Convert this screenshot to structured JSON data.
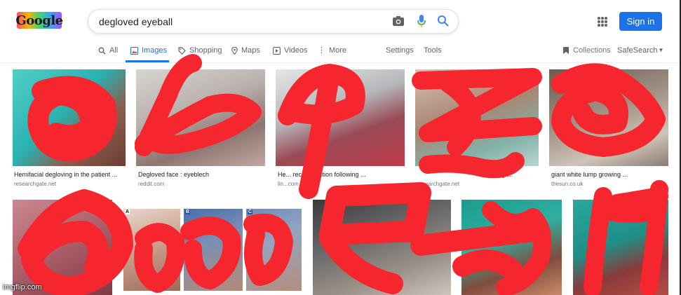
{
  "header": {
    "logo_text": "Google",
    "query": "degloved eyeball",
    "signin_label": "Sign in"
  },
  "tabs": [
    {
      "label": "All",
      "icon": "search-icon"
    },
    {
      "label": "Images",
      "icon": "image-icon",
      "active": true
    },
    {
      "label": "Shopping",
      "icon": "tag-icon"
    },
    {
      "label": "Maps",
      "icon": "map-pin-icon"
    },
    {
      "label": "Videos",
      "icon": "play-icon"
    },
    {
      "label": "More",
      "icon": "more-dots-icon"
    }
  ],
  "tools": {
    "settings": "Settings",
    "tools": "Tools"
  },
  "right_tools": {
    "collections": "Collections",
    "safesearch": "SafeSearch"
  },
  "results": [
    {
      "title": "Hemifacial degloving in the patient ...",
      "source": "researchgate.net"
    },
    {
      "title": "Degloved face : eyeblech",
      "source": "reddit.com"
    },
    {
      "title": "He... reconstruction following ...",
      "source": "lin...com"
    },
    {
      "title": "...ry ...",
      "source": "researchgate.net"
    },
    {
      "title": "giant white lump growing ...",
      "source": "thesun.co.uk"
    }
  ],
  "panel_letters": [
    "A",
    "B",
    "C"
  ],
  "watermark": "imgflip.com",
  "colors": {
    "accent": "#1a73e8",
    "redaction": "#f5262e"
  }
}
